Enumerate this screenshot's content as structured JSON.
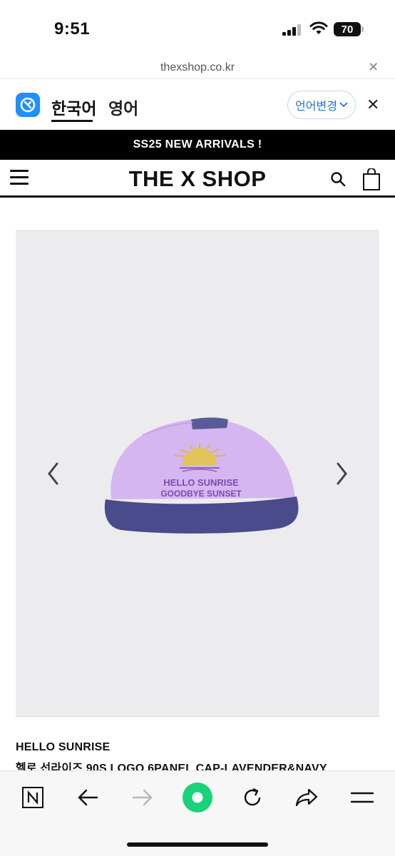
{
  "status": {
    "time": "9:51",
    "battery": "70"
  },
  "browser": {
    "url": "thexshop.co.kr"
  },
  "translate": {
    "tab_korean": "한국어",
    "tab_english": "영어",
    "change_language": "언어변경"
  },
  "banner": {
    "text": "SS25 NEW ARRIVALS !"
  },
  "header": {
    "brand": "THE X SHOP"
  },
  "product": {
    "image": {
      "cap_text_line1": "HELLO SUNRISE",
      "cap_text_line2": "GOODBYE SUNSET"
    },
    "brand": "HELLO SUNRISE",
    "name": "헬로 선라이즈 90S LOGO 6PANEL CAP-LAVENDER&NAVY"
  },
  "colors": {
    "banner_bg": "#000000",
    "accent_blue": "#1f74d6",
    "reload_green": "#19d27a",
    "cap_lavender": "#d6b6f0",
    "cap_navy": "#4b4a8c"
  },
  "toolbar": {
    "icons": [
      "naver-icon",
      "back-icon",
      "forward-icon",
      "home-green-icon",
      "reload-icon",
      "share-icon",
      "menu-icon"
    ]
  }
}
